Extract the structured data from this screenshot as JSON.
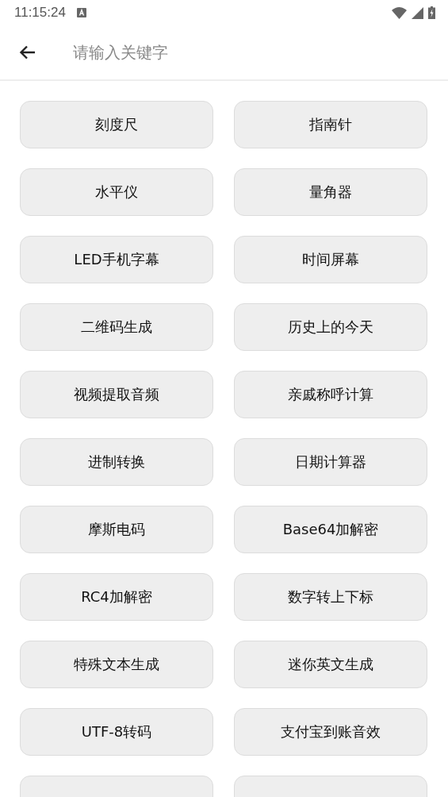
{
  "status_bar": {
    "time": "11:15:24"
  },
  "search": {
    "placeholder": "请输入关键字"
  },
  "tools": [
    {
      "label": "刻度尺"
    },
    {
      "label": "指南针"
    },
    {
      "label": "水平仪"
    },
    {
      "label": "量角器"
    },
    {
      "label": "LED手机字幕"
    },
    {
      "label": "时间屏幕"
    },
    {
      "label": "二维码生成"
    },
    {
      "label": "历史上的今天"
    },
    {
      "label": "视频提取音频"
    },
    {
      "label": "亲戚称呼计算"
    },
    {
      "label": "进制转换"
    },
    {
      "label": "日期计算器"
    },
    {
      "label": "摩斯电码"
    },
    {
      "label": "Base64加解密"
    },
    {
      "label": "RC4加解密"
    },
    {
      "label": "数字转上下标"
    },
    {
      "label": "特殊文本生成"
    },
    {
      "label": "迷你英文生成"
    },
    {
      "label": "UTF-8转码"
    },
    {
      "label": "支付宝到账音效"
    }
  ],
  "cut_off_tiles": [
    {
      "kind": "tile"
    },
    {
      "kind": "tile"
    }
  ]
}
